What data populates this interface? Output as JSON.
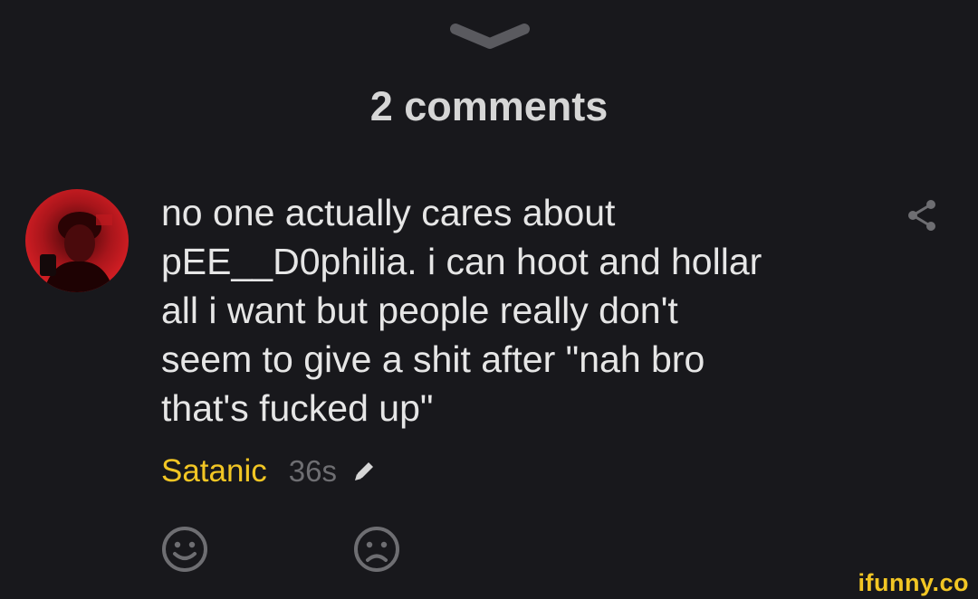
{
  "header": {
    "title": "2 comments"
  },
  "comment": {
    "text": "no one actually cares about\npEE__D0philia. i can hoot and hollar\nall i want but people really don't\nseem to give a shit after \"nah bro\nthat's fucked up\"",
    "author": "Satanic",
    "time": "36s"
  },
  "watermark": {
    "text": "ifunny.co"
  },
  "colors": {
    "background": "#18181c",
    "author": "#f2c624",
    "text": "#e6e6e6",
    "muted": "#6e6e72"
  },
  "icons": {
    "collapse": "chevron-down-icon",
    "share": "share-icon",
    "edit": "pencil-icon",
    "smile": "smile-icon",
    "frown": "frown-icon"
  }
}
